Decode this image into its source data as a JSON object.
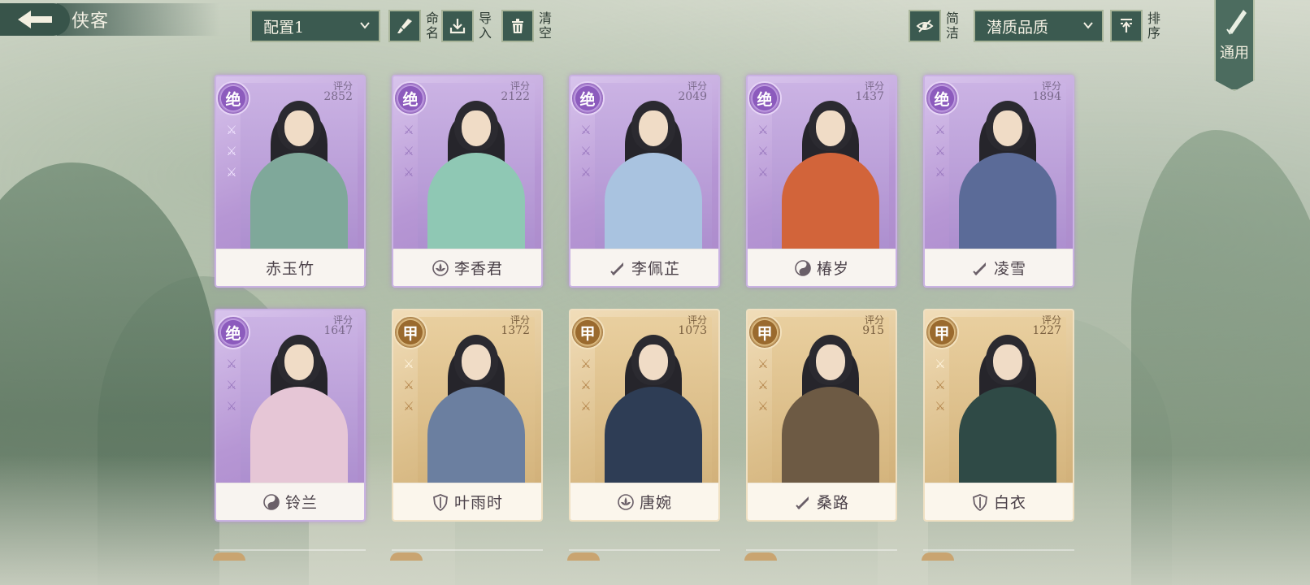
{
  "header": {
    "title": "侠客",
    "config_select": "配置1",
    "rename_label": "命名",
    "import_label": "导入",
    "clear_label": "清空",
    "simple_label": "简洁",
    "sort_select": "潜质品质",
    "sort_label": "排序",
    "common_label": "通用"
  },
  "colors": {
    "panel": "#3b5a50",
    "jue_card": "#b696d4",
    "jia_card": "#dcbf8b"
  },
  "cards": [
    {
      "grade": "绝",
      "score_label": "评分",
      "score": "2852",
      "name": "赤玉竹",
      "faction_icon": "",
      "stars": 3,
      "tier": "jue",
      "body_color": "#7fa89a"
    },
    {
      "grade": "绝",
      "score_label": "评分",
      "score": "2122",
      "name": "李香君",
      "faction_icon": "lotus-icon",
      "stars": 0,
      "tier": "jue",
      "body_color": "#8fc8b4"
    },
    {
      "grade": "绝",
      "score_label": "评分",
      "score": "2049",
      "name": "李佩芷",
      "faction_icon": "sword-icon",
      "stars": 0,
      "tier": "jue",
      "body_color": "#a9c3e0"
    },
    {
      "grade": "绝",
      "score_label": "评分",
      "score": "1437",
      "name": "椿岁",
      "faction_icon": "yinyang-icon",
      "stars": 0,
      "tier": "jue",
      "body_color": "#d2643a"
    },
    {
      "grade": "绝",
      "score_label": "评分",
      "score": "1894",
      "name": "凌雪",
      "faction_icon": "sword-icon",
      "stars": 0,
      "tier": "jue",
      "body_color": "#5b6b98"
    },
    {
      "grade": "绝",
      "score_label": "评分",
      "score": "1647",
      "name": "铃兰",
      "faction_icon": "yinyang-icon",
      "stars": 0,
      "tier": "jue",
      "body_color": "#e6c6d6"
    },
    {
      "grade": "甲",
      "score_label": "评分",
      "score": "1372",
      "name": "叶雨时",
      "faction_icon": "shield-icon",
      "stars": 1,
      "tier": "jia",
      "body_color": "#6b7fa0"
    },
    {
      "grade": "甲",
      "score_label": "评分",
      "score": "1073",
      "name": "唐婉",
      "faction_icon": "lotus-icon",
      "stars": 0,
      "tier": "jia",
      "body_color": "#2e3d55"
    },
    {
      "grade": "甲",
      "score_label": "评分",
      "score": "915",
      "name": "桑路",
      "faction_icon": "sword-icon",
      "stars": 0,
      "tier": "jia",
      "body_color": "#6d5a44"
    },
    {
      "grade": "甲",
      "score_label": "评分",
      "score": "1227",
      "name": "白衣",
      "faction_icon": "shield-icon",
      "stars": 1,
      "tier": "jia",
      "body_color": "#2f4a46"
    }
  ]
}
